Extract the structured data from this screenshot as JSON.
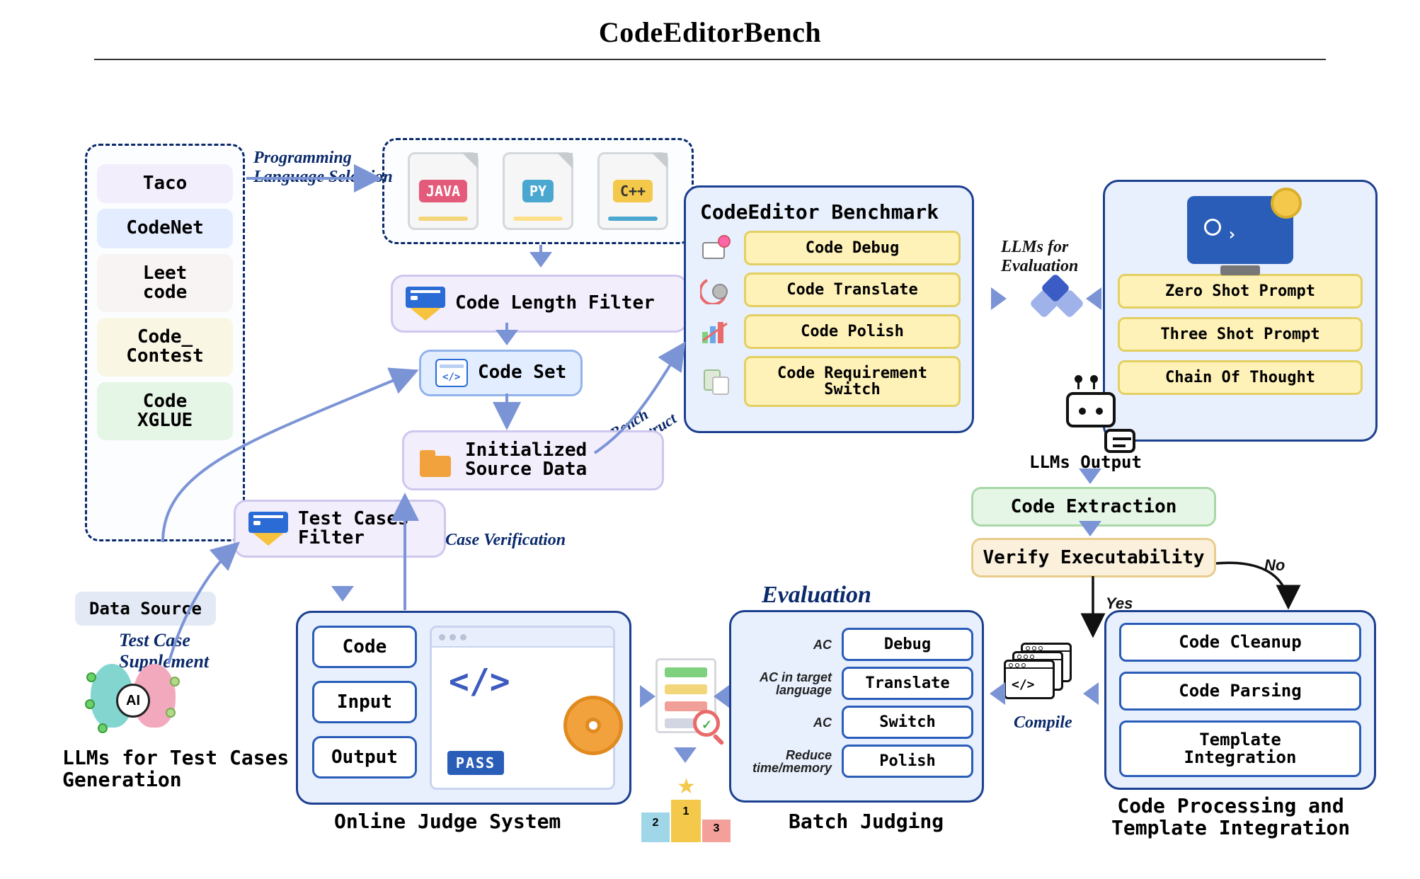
{
  "title": "CodeEditorBench",
  "data_sources": {
    "label": "Data Source",
    "items": [
      {
        "label": "Taco",
        "bg": "#f3eefc"
      },
      {
        "label": "CodeNet",
        "bg": "#e4ecff"
      },
      {
        "label": "Leet\ncode",
        "bg": "#f9f4f4"
      },
      {
        "label": "Code_\nContest",
        "bg": "#f9f6e4"
      },
      {
        "label": "Code\nXGLUE",
        "bg": "#e6f6e6"
      }
    ]
  },
  "edge_labels": {
    "lang_select": "Programming\nLanguage Selection",
    "bench_construct": "Bench\nConstruct",
    "tc_supplement": "Test Case\nSupplement",
    "tc_verify": "Test Case Verification",
    "llms_eval": "LLMs for\nEvaluation",
    "llms_output": "LLMs Output",
    "compile": "Compile",
    "yes": "Yes",
    "no": "No"
  },
  "languages": [
    {
      "name": "JAVA",
      "color": "#e45a7a",
      "accent": "#f3d57a"
    },
    {
      "name": "PY",
      "color": "#4aa7cf",
      "accent": "#ffe08a"
    },
    {
      "name": "C++",
      "color": "#f4c84a",
      "accent": "#4aa7cf"
    }
  ],
  "filters": {
    "code_length": "Code Length Filter",
    "test_cases": "Test Cases\nFilter"
  },
  "code_set": "Code Set",
  "source_data": "Initialized\nSource Data",
  "ojs": {
    "title": "Online Judge System",
    "items": [
      "Code",
      "Input",
      "Output"
    ],
    "pass": "PASS"
  },
  "ai_caption": "LLMs for Test Cases\nGeneration",
  "ai_core": "AI",
  "benchmark": {
    "title": "CodeEditor Benchmark",
    "items": [
      "Code Debug",
      "Code Translate",
      "Code Polish",
      "Code Requirement\nSwitch"
    ]
  },
  "prompts": {
    "items": [
      "Zero Shot Prompt",
      "Three Shot Prompt",
      "Chain Of Thought"
    ]
  },
  "extraction": "Code Extraction",
  "verify": "Verify Executability",
  "evaluation_label": "Evaluation",
  "batch": {
    "title": "Batch Judging",
    "rows": [
      {
        "note": "AC",
        "label": "Debug"
      },
      {
        "note": "AC in target\nlanguage",
        "label": "Translate"
      },
      {
        "note": "AC",
        "label": "Switch"
      },
      {
        "note": "Reduce\ntime/memory",
        "label": "Polish"
      }
    ]
  },
  "processing": {
    "title": "Code Processing and\nTemplate Integration",
    "items": [
      "Code Cleanup",
      "Code Parsing",
      "Template\nIntegration"
    ]
  },
  "podium": {
    "first": "1",
    "second": "2",
    "third": "3"
  },
  "code_glyph": "</>"
}
